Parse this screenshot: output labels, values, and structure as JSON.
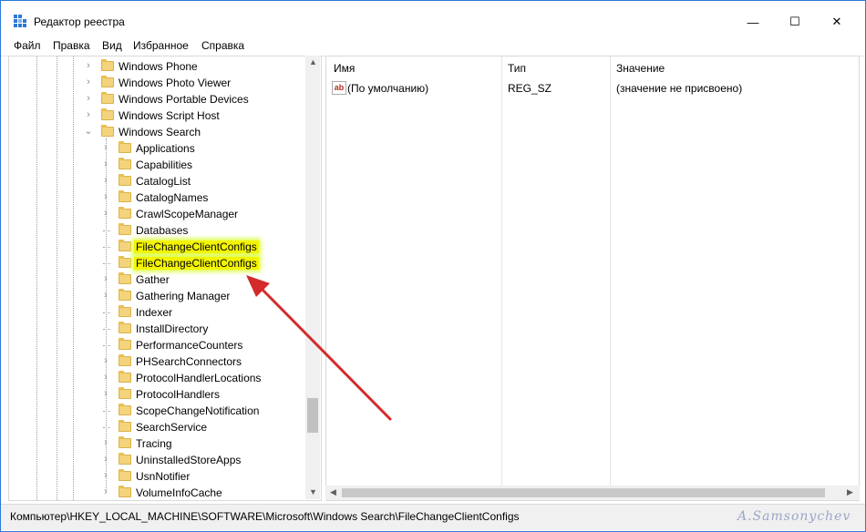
{
  "window": {
    "title": "Редактор реестра"
  },
  "controls": {
    "minimize": "—",
    "maximize": "☐",
    "close": "✕"
  },
  "menu": [
    "Файл",
    "Правка",
    "Вид",
    "Избранное",
    "Справка"
  ],
  "tree": {
    "parents": [
      {
        "label": "Windows Phone",
        "expander": ">"
      },
      {
        "label": "Windows Photo Viewer",
        "expander": ">"
      },
      {
        "label": "Windows Portable Devices",
        "expander": ">"
      },
      {
        "label": "Windows Script Host",
        "expander": ">"
      },
      {
        "label": "Windows Search",
        "expander": "v"
      }
    ],
    "children": [
      {
        "label": "Applications",
        "expander": ">"
      },
      {
        "label": "Capabilities",
        "expander": ">"
      },
      {
        "label": "CatalogList",
        "expander": ">"
      },
      {
        "label": "CatalogNames",
        "expander": ">"
      },
      {
        "label": "CrawlScopeManager",
        "expander": ">"
      },
      {
        "label": "Databases",
        "expander": ""
      },
      {
        "label": "FileChangeClientConfigs",
        "expander": "",
        "highlight": true
      },
      {
        "label": "FileChangeClientConfigs",
        "expander": "",
        "highlight": true
      },
      {
        "label": "Gather",
        "expander": ">"
      },
      {
        "label": "Gathering Manager",
        "expander": ">"
      },
      {
        "label": "Indexer",
        "expander": ""
      },
      {
        "label": "InstallDirectory",
        "expander": ""
      },
      {
        "label": "PerformanceCounters",
        "expander": ""
      },
      {
        "label": "PHSearchConnectors",
        "expander": ">"
      },
      {
        "label": "ProtocolHandlerLocations",
        "expander": ">"
      },
      {
        "label": "ProtocolHandlers",
        "expander": ">"
      },
      {
        "label": "ScopeChangeNotification",
        "expander": ""
      },
      {
        "label": "SearchService",
        "expander": ""
      },
      {
        "label": "Tracing",
        "expander": ">"
      },
      {
        "label": "UninstalledStoreApps",
        "expander": ">"
      },
      {
        "label": "UsnNotifier",
        "expander": ">"
      },
      {
        "label": "VolumeInfoCache",
        "expander": ">"
      }
    ]
  },
  "values_table": {
    "headers": [
      "Имя",
      "Тип",
      "Значение"
    ],
    "rows": [
      {
        "icon": "ab",
        "name": "(По умолчанию)",
        "type": "REG_SZ",
        "value": "(значение не присвоено)"
      }
    ]
  },
  "status_bar": {
    "path": "Компьютер\\HKEY_LOCAL_MACHINE\\SOFTWARE\\Microsoft\\Windows Search\\FileChangeClientConfigs"
  },
  "watermark": "A.Samsonychev",
  "colors": {
    "highlight": "#f4f400",
    "arrow": "#d42a2a",
    "accent": "#2b79d8"
  }
}
